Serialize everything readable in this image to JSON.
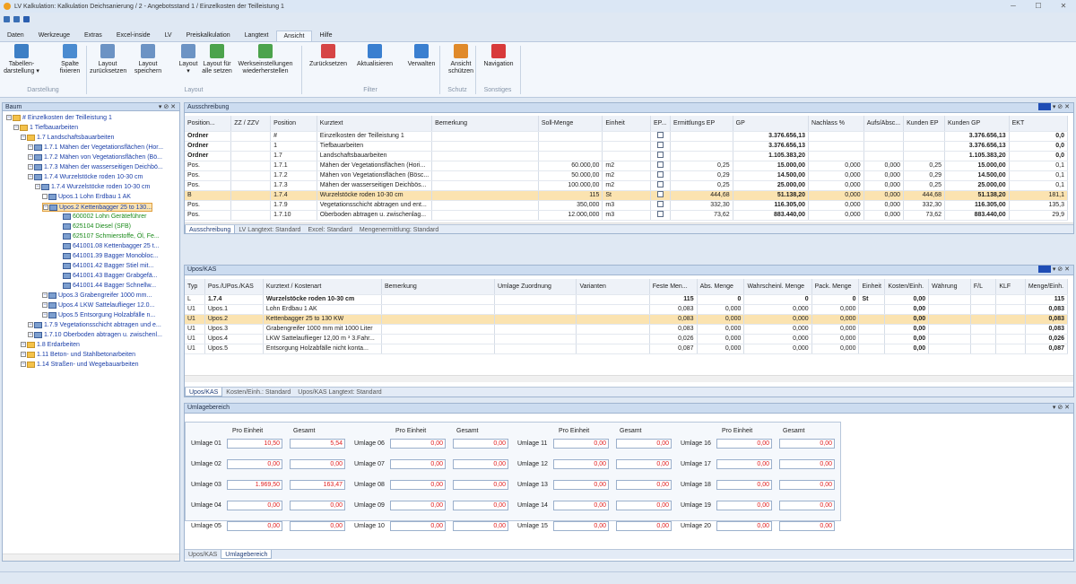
{
  "window": {
    "title": "LV Kalkulation: Kalkulation Deichsanierung / 2 - Angebotsstand 1 / Einzelkosten der Teilleistung 1"
  },
  "menu": [
    "Daten",
    "Werkzeuge",
    "Extras",
    "Excel-inside",
    "LV",
    "Preiskalkulation",
    "Langtext",
    "Ansicht",
    "Hilfe"
  ],
  "ribbon": {
    "buttons": [
      {
        "l1": "Tabellen-",
        "l2": "darstellung ▾",
        "icon": "table-view-icon"
      },
      {
        "l1": "Spalte",
        "l2": "fixieren",
        "icon": "freeze-column-icon"
      },
      {
        "l1": "Layout",
        "l2": "zurücksetzen",
        "icon": "layout-reset-icon"
      },
      {
        "l1": "Layout",
        "l2": "speichern",
        "icon": "layout-save-icon"
      },
      {
        "l1": "Layout",
        "l2": "▾",
        "icon": "layout-icon"
      },
      {
        "l1": "Layout für",
        "l2": "alle setzen",
        "icon": "layout-all-icon"
      },
      {
        "l1": "Werkseinstellungen",
        "l2": "wiederherstellen",
        "icon": "factory-reset-icon"
      },
      {
        "l1": "Zurücksetzen",
        "l2": "",
        "icon": "filter-reset-icon"
      },
      {
        "l1": "Aktualisieren",
        "l2": "",
        "icon": "filter-refresh-icon"
      },
      {
        "l1": "Verwalten",
        "l2": "",
        "icon": "filter-manage-icon"
      },
      {
        "l1": "Ansicht",
        "l2": "schützen",
        "icon": "lock-view-icon"
      },
      {
        "l1": "Navigation",
        "l2": "",
        "icon": "navigation-icon"
      }
    ],
    "groups": [
      "Darstellung",
      "Layout",
      "Filter",
      "Schutz",
      "Sonstiges"
    ]
  },
  "tree": {
    "title": "Baum",
    "rows": [
      {
        "t": "# Einzelkosten der Teilleistung 1",
        "c": "blue"
      },
      {
        "t": "1 Tiefbauarbeiten",
        "c": "blue"
      },
      {
        "t": "1.7 Landschaftsbauarbeiten",
        "c": "blue"
      },
      {
        "t": "1.7.1 Mähen der Vegetationsflächen (Hor...",
        "c": "blue"
      },
      {
        "t": "1.7.2 Mähen von Vegetationsflächen (Bö...",
        "c": "blue"
      },
      {
        "t": "1.7.3 Mähen der wasserseitigen Deichbö...",
        "c": "blue"
      },
      {
        "t": "1.7.4 Wurzelstöcke roden 10-30 cm",
        "c": "blue"
      },
      {
        "t": "1.7.4 Wurzelstöcke roden 10-30 cm",
        "c": "blue"
      },
      {
        "t": "Upos.1 Lohn Erdbau   1 AK",
        "c": "blue"
      },
      {
        "t": "Upos.2 Kettenbagger 25 to 130...",
        "c": "blue"
      },
      {
        "t": "600002 Lohn Geräteführer",
        "c": "green"
      },
      {
        "t": "625104 Diesel (SFB)",
        "c": "green"
      },
      {
        "t": "625107 Schmierstoffe, Öl, Fe...",
        "c": "green"
      },
      {
        "t": "641001.08 Kettenbagger 25 t...",
        "c": "blue"
      },
      {
        "t": "641001.39 Bagger Monobloc...",
        "c": "blue"
      },
      {
        "t": "641001.42 Bagger Stiel mit...",
        "c": "blue"
      },
      {
        "t": "641001.43 Bagger Grabgefä...",
        "c": "blue"
      },
      {
        "t": "641001.44 Bagger Schnellw...",
        "c": "blue"
      },
      {
        "t": "Upos.3 Grabengreifer 1000 mm...",
        "c": "blue"
      },
      {
        "t": "Upos.4 LKW Sattelauflieger 12.0...",
        "c": "blue"
      },
      {
        "t": "Upos.5 Entsorgung Holzabfälle n...",
        "c": "blue"
      },
      {
        "t": "1.7.9 Vegetationsschicht abtragen und e...",
        "c": "blue"
      },
      {
        "t": "1.7.10 Oberboden abtragen u. zwischenl...",
        "c": "blue"
      },
      {
        "t": "1.8 Erdarbeiten",
        "c": "blue"
      },
      {
        "t": "1.11 Beton- und Stahlbetonarbeiten",
        "c": "blue"
      },
      {
        "t": "1.14 Straßen- und Wegebauarbeiten",
        "c": "blue"
      }
    ]
  },
  "aus": {
    "title": "Ausschreibung",
    "cols": [
      "Position...",
      "ZZ / ZZV",
      "Position",
      "Kurztext",
      "Bemerkung",
      "Soll-Menge",
      "Einheit",
      "EP...",
      "Ermittlungs EP",
      "GP",
      "Nachlass %",
      "Aufs/Absc...",
      "Kunden EP",
      "Kunden GP",
      "EKT"
    ],
    "rows": [
      [
        "Ordner",
        "",
        "#",
        "Einzelkosten der Teilleistung 1",
        "",
        "",
        "",
        "",
        "",
        "3.376.656,13",
        "",
        "",
        "",
        "3.376.656,13",
        "0,0"
      ],
      [
        "Ordner",
        "",
        "1",
        "Tiefbauarbeiten",
        "",
        "",
        "",
        "",
        "",
        "3.376.656,13",
        "",
        "",
        "",
        "3.376.656,13",
        "0,0"
      ],
      [
        "Ordner",
        "",
        "1.7",
        "Landschaftsbauarbeiten",
        "",
        "",
        "",
        "",
        "",
        "1.105.383,20",
        "",
        "",
        "",
        "1.105.383,20",
        "0,0"
      ],
      [
        "Pos.",
        "",
        "1.7.1",
        "Mähen der Vegetationsflächen (Hori...",
        "",
        "60.000,00",
        "m2",
        "",
        "0,25",
        "15.000,00",
        "0,000",
        "0,000",
        "0,25",
        "15.000,00",
        "0,1"
      ],
      [
        "Pos.",
        "",
        "1.7.2",
        "Mähen von Vegetationsflächen (Bösc...",
        "",
        "50.000,00",
        "m2",
        "",
        "0,29",
        "14.500,00",
        "0,000",
        "0,000",
        "0,29",
        "14.500,00",
        "0,1"
      ],
      [
        "Pos.",
        "",
        "1.7.3",
        "Mähen der wasserseitigen Deichbös...",
        "",
        "100.000,00",
        "m2",
        "",
        "0,25",
        "25.000,00",
        "0,000",
        "0,000",
        "0,25",
        "25.000,00",
        "0,1"
      ],
      [
        "B",
        "",
        "1.7.4",
        "Wurzelstöcke roden 10-30 cm",
        "",
        "115",
        "St",
        "",
        "444,68",
        "51.138,20",
        "0,000",
        "0,000",
        "444,68",
        "51.138,20",
        "181,1"
      ],
      [
        "Pos.",
        "",
        "1.7.9",
        "Vegetationsschicht abtragen und ent...",
        "",
        "350,000",
        "m3",
        "",
        "332,30",
        "116.305,00",
        "0,000",
        "0,000",
        "332,30",
        "116.305,00",
        "135,3"
      ],
      [
        "Pos.",
        "",
        "1.7.10",
        "Oberboden abtragen u. zwischenlag...",
        "",
        "12.000,000",
        "m3",
        "",
        "73,62",
        "883.440,00",
        "0,000",
        "0,000",
        "73,62",
        "883.440,00",
        "29,9"
      ]
    ],
    "tabs": [
      "Ausschreibung",
      "LV Langtext: Standard",
      "Excel: Standard",
      "Mengenermittlung: Standard"
    ]
  },
  "upos": {
    "title": "Upos/KAS",
    "cols": [
      "Typ",
      "Pos./UPos./KAS",
      "Kurztext / Kostenart",
      "Bemerkung",
      "Umlage Zuordnung",
      "Varianten",
      "Feste Men...",
      "Abs. Menge",
      "Wahrscheinl. Menge",
      "Pack. Menge",
      "Einheit",
      "Kosten/Einh.",
      "Währung",
      "F/L",
      "KLF",
      "Menge/Einh."
    ],
    "rows": [
      [
        "L",
        "1.7.4",
        "Wurzelstöcke roden 10-30 cm",
        "",
        "",
        "",
        "115",
        "0",
        "0",
        "0",
        "St",
        "0,00",
        "",
        "",
        "",
        "115"
      ],
      [
        "U1",
        "Upos.1",
        "Lohn Erdbau   1 AK",
        "",
        "",
        "",
        "0,083",
        "0,000",
        "0,000",
        "0,000",
        "",
        "0,00",
        "",
        "",
        "",
        "0,083"
      ],
      [
        "U1",
        "Upos.2",
        "Kettenbagger 25 to 130 KW",
        "",
        "",
        "",
        "0,083",
        "0,000",
        "0,000",
        "0,000",
        "",
        "0,00",
        "",
        "",
        "",
        "0,083"
      ],
      [
        "U1",
        "Upos.3",
        "Grabengreifer 1000 mm mit 1000 Liter",
        "",
        "",
        "",
        "0,083",
        "0,000",
        "0,000",
        "0,000",
        "",
        "0,00",
        "",
        "",
        "",
        "0,083"
      ],
      [
        "U1",
        "Upos.4",
        "LKW Sattelauflieger 12,00 m ³  3.Fahr...",
        "",
        "",
        "",
        "0,026",
        "0,000",
        "0,000",
        "0,000",
        "",
        "0,00",
        "",
        "",
        "",
        "0,026"
      ],
      [
        "U1",
        "Upos.5",
        "Entsorgung Holzabfälle nicht konta...",
        "",
        "",
        "",
        "0,087",
        "0,000",
        "0,000",
        "0,000",
        "",
        "0,00",
        "",
        "",
        "",
        "0,087"
      ]
    ],
    "tabs": [
      "Upos/KAS",
      "Kosten/Einh.: Standard",
      "Upos/KAS Langtext: Standard"
    ]
  },
  "umlage": {
    "title": "Umlagebereich",
    "h1": "Pro Einheit",
    "h2": "Gesamt",
    "items": [
      {
        "l": "Umlage 01",
        "p": "10,50",
        "g": "5,54"
      },
      {
        "l": "Umlage 02",
        "p": "0,00",
        "g": "0,00"
      },
      {
        "l": "Umlage 03",
        "p": "1.969,50",
        "g": "163,47"
      },
      {
        "l": "Umlage 04",
        "p": "0,00",
        "g": "0,00"
      },
      {
        "l": "Umlage 05",
        "p": "0,00",
        "g": "0,00"
      },
      {
        "l": "Umlage 06",
        "p": "0,00",
        "g": "0,00"
      },
      {
        "l": "Umlage 07",
        "p": "0,00",
        "g": "0,00"
      },
      {
        "l": "Umlage 08",
        "p": "0,00",
        "g": "0,00"
      },
      {
        "l": "Umlage 09",
        "p": "0,00",
        "g": "0,00"
      },
      {
        "l": "Umlage 10",
        "p": "0,00",
        "g": "0,00"
      },
      {
        "l": "Umlage 11",
        "p": "0,00",
        "g": "0,00"
      },
      {
        "l": "Umlage 12",
        "p": "0,00",
        "g": "0,00"
      },
      {
        "l": "Umlage 13",
        "p": "0,00",
        "g": "0,00"
      },
      {
        "l": "Umlage 14",
        "p": "0,00",
        "g": "0,00"
      },
      {
        "l": "Umlage 15",
        "p": "0,00",
        "g": "0,00"
      },
      {
        "l": "Umlage 16",
        "p": "0,00",
        "g": "0,00"
      },
      {
        "l": "Umlage 17",
        "p": "0,00",
        "g": "0,00"
      },
      {
        "l": "Umlage 18",
        "p": "0,00",
        "g": "0,00"
      },
      {
        "l": "Umlage 19",
        "p": "0,00",
        "g": "0,00"
      },
      {
        "l": "Umlage 20",
        "p": "0,00",
        "g": "0,00"
      }
    ],
    "tabs": [
      "Upos/KAS",
      "Umlagebereich"
    ]
  }
}
